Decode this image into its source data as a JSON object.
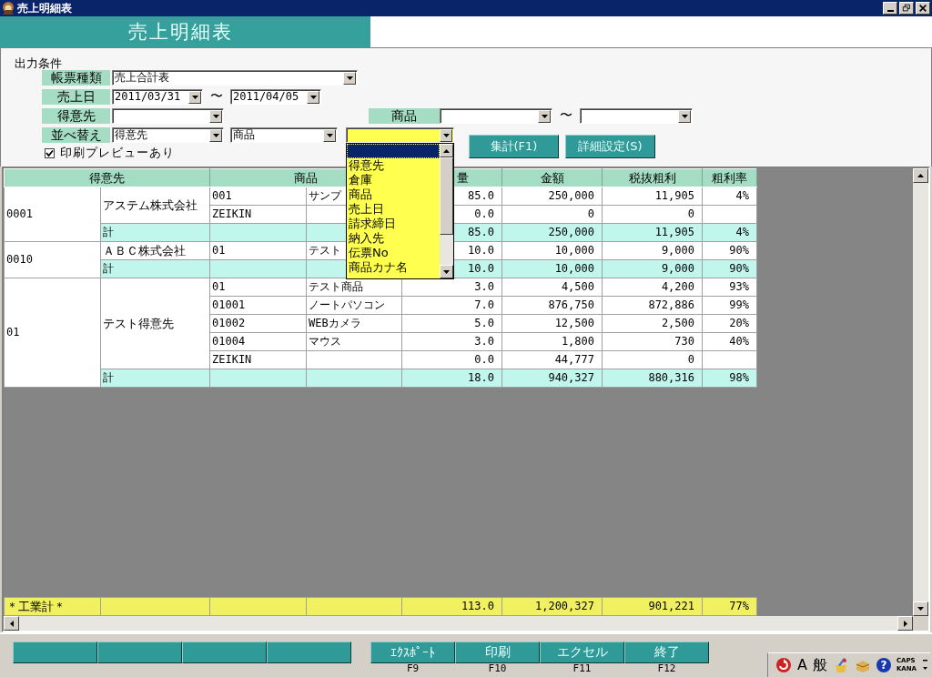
{
  "window": {
    "title": "売上明細表"
  },
  "header": {
    "title": "売上明細表"
  },
  "conditions": {
    "heading": "出力条件",
    "report_type": {
      "label": "帳票種類",
      "value": "売上合計表"
    },
    "sales_date": {
      "label": "売上日",
      "from": "2011/03/31",
      "separator": "〜",
      "to": "2011/04/05"
    },
    "customer": {
      "label": "得意先"
    },
    "product": {
      "label": "商品",
      "separator": "〜"
    },
    "sort": {
      "label": "並べ替え",
      "keys": [
        {
          "value": "得意先",
          "focused": false
        },
        {
          "value": "商品",
          "focused": false
        },
        {
          "focused": true,
          "open": true,
          "options": [
            {
              "kind": "blank",
              "selected": true
            },
            {
              "kind": "option",
              "label": "得意先",
              "selected": false
            },
            {
              "kind": "option",
              "label": "倉庫",
              "selected": false
            },
            {
              "kind": "option",
              "label": "商品",
              "selected": false
            },
            {
              "kind": "option",
              "label": "売上日",
              "selected": false
            },
            {
              "kind": "option",
              "label": "請求締日",
              "selected": false
            },
            {
              "kind": "option",
              "label": "納入先",
              "selected": false
            },
            {
              "kind": "option",
              "label": "伝票No",
              "selected": false
            },
            {
              "kind": "option",
              "label": "商品カナ名",
              "selected": false
            }
          ]
        }
      ]
    },
    "print_preview": {
      "label": "印刷プレビューあり",
      "checked": true
    },
    "buttons": [
      {
        "label": "集計(F1)"
      },
      {
        "label": "詳細設定(S)"
      }
    ]
  },
  "table": {
    "columns": [
      {
        "label": "得意先"
      },
      {
        "label": "商品"
      },
      {
        "label": "量"
      },
      {
        "label": "金額"
      },
      {
        "label": "税抜粗利"
      },
      {
        "label": "粗利率"
      }
    ],
    "groups": [
      {
        "code": "0001",
        "name": "アステム株式会社",
        "lines": [
          {
            "product_code": "001",
            "product_name": "サンプ",
            "qty": "85.0",
            "amount": "250,000",
            "profit": "11,905",
            "rate": "4%"
          },
          {
            "product_code": "ZEIKIN",
            "qty": "0.0",
            "amount": "0",
            "profit": "0"
          }
        ],
        "subtotal": {
          "label": "計",
          "qty": "85.0",
          "amount": "250,000",
          "profit": "11,905",
          "rate": "4%"
        }
      },
      {
        "code": "0010",
        "name": "ＡＢＣ株式会社",
        "lines": [
          {
            "product_code": "01",
            "product_name": "テスト",
            "qty": "10.0",
            "amount": "10,000",
            "profit": "9,000",
            "rate": "90%"
          }
        ],
        "subtotal": {
          "label": "計",
          "qty": "10.0",
          "amount": "10,000",
          "profit": "9,000",
          "rate": "90%"
        }
      },
      {
        "code": "01",
        "name": "テスト得意先",
        "lines": [
          {
            "product_code": "01",
            "product_name": "テスト商品",
            "qty": "3.0",
            "amount": "4,500",
            "profit": "4,200",
            "rate": "93%"
          },
          {
            "product_code": "01001",
            "product_name": "ノートパソコン",
            "qty": "7.0",
            "amount": "876,750",
            "profit": "872,886",
            "rate": "99%"
          },
          {
            "product_code": "01002",
            "product_name": "WEBカメラ",
            "qty": "5.0",
            "amount": "12,500",
            "profit": "2,500",
            "rate": "20%"
          },
          {
            "product_code": "01004",
            "product_name": "マウス",
            "qty": "3.0",
            "amount": "1,800",
            "profit": "730",
            "rate": "40%"
          },
          {
            "product_code": "ZEIKIN",
            "qty": "0.0",
            "amount": "44,777",
            "profit": "0"
          }
        ],
        "subtotal": {
          "label": "計",
          "qty": "18.0",
          "amount": "940,327",
          "profit": "880,316",
          "rate": "98%"
        }
      }
    ],
    "grand_total": {
      "label": "＊工業計＊",
      "qty": "113.0",
      "amount": "1,200,327",
      "profit": "901,221",
      "rate": "77%"
    }
  },
  "function_keys": [
    {
      "kind": "blank"
    },
    {
      "kind": "blank"
    },
    {
      "kind": "blank"
    },
    {
      "kind": "blank"
    },
    {
      "kind": "action",
      "label": "ｴｸｽﾎﾟｰﾄ",
      "key": "F9"
    },
    {
      "kind": "action",
      "label": "印刷",
      "key": "F10"
    },
    {
      "kind": "action",
      "label": "エクセル",
      "key": "F11"
    },
    {
      "kind": "action",
      "label": "終了",
      "key": "F12"
    }
  ],
  "ime_bar": {
    "mode": "A",
    "charset": "般",
    "help": "?",
    "caps": "CAPS",
    "kana": "KANA"
  }
}
